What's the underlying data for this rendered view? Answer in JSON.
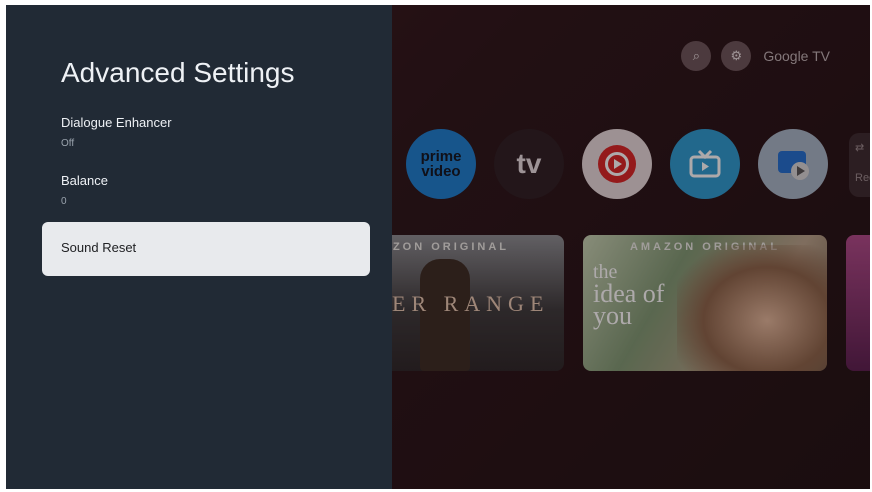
{
  "panel": {
    "title": "Advanced Settings",
    "items": [
      {
        "label": "Dialogue Enhancer",
        "value": "Off"
      },
      {
        "label": "Balance",
        "value": "0"
      }
    ],
    "focused_item": {
      "label": "Sound Reset"
    }
  },
  "home": {
    "brand": "Google TV",
    "top_icons": [
      "search-icon",
      "gear-icon"
    ],
    "apps": [
      {
        "name": "prime-video",
        "line1": "prime",
        "line2": "video"
      },
      {
        "name": "apple-tv",
        "label": "\u0000tv"
      },
      {
        "name": "youtube-music"
      },
      {
        "name": "live-tv"
      },
      {
        "name": "files"
      }
    ],
    "partial_app_label": "Rec",
    "cards": [
      {
        "banner": "AZON ORIGINAL",
        "title": "ER RANGE"
      },
      {
        "banner": "AMAZON ORIGINAL",
        "title_line1": "the",
        "title_line2": "idea of",
        "title_line3": "you"
      }
    ]
  },
  "colors": {
    "panel_bg": "#212a35",
    "focus_bg": "#e8eaed"
  }
}
